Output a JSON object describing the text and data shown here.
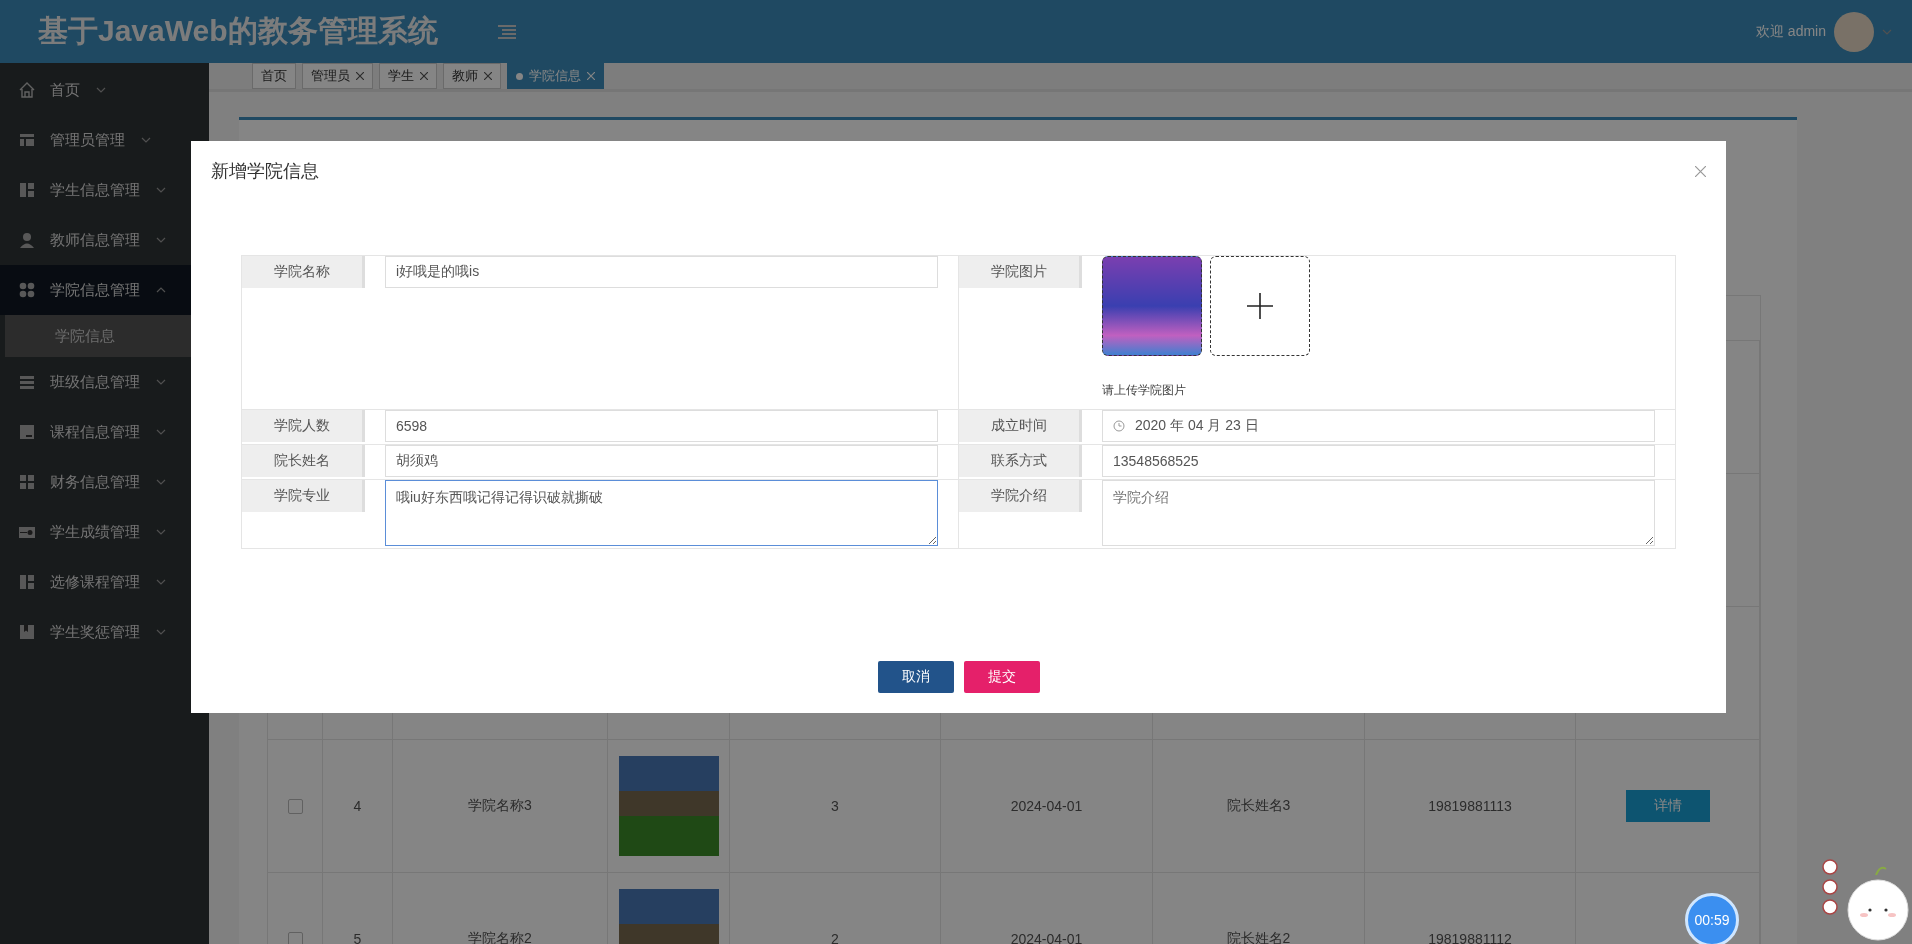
{
  "header": {
    "title": "基于JavaWeb的教务管理系统",
    "welcome": "欢迎 admin"
  },
  "sidebar": {
    "items": [
      {
        "label": "首页",
        "expanded": false
      },
      {
        "label": "管理员管理",
        "expanded": false
      },
      {
        "label": "学生信息管理",
        "expanded": false
      },
      {
        "label": "教师信息管理",
        "expanded": false
      },
      {
        "label": "学院信息管理",
        "expanded": true,
        "children": [
          {
            "label": "学院信息",
            "selected": true
          }
        ]
      },
      {
        "label": "班级信息管理",
        "expanded": false
      },
      {
        "label": "课程信息管理",
        "expanded": false
      },
      {
        "label": "财务信息管理",
        "expanded": false
      },
      {
        "label": "学生成绩管理",
        "expanded": false
      },
      {
        "label": "选修课程管理",
        "expanded": false
      },
      {
        "label": "学生奖惩管理",
        "expanded": false
      }
    ]
  },
  "tabs": [
    {
      "label": "首页",
      "closable": false,
      "selected": false
    },
    {
      "label": "管理员",
      "closable": true,
      "selected": false
    },
    {
      "label": "学生",
      "closable": true,
      "selected": false
    },
    {
      "label": "教师",
      "closable": true,
      "selected": false
    },
    {
      "label": "学院信息",
      "closable": true,
      "selected": true
    }
  ],
  "table": {
    "rows": [
      {
        "checked": false,
        "index": "4",
        "name": "学院名称3",
        "count": "3",
        "date": "2024-04-01",
        "dean": "院长姓名3",
        "phone": "19819881113",
        "action": "详情"
      },
      {
        "checked": false,
        "index": "5",
        "name": "学院名称2",
        "count": "2",
        "date": "2024-04-01",
        "dean": "院长姓名2",
        "phone": "19819881112"
      }
    ]
  },
  "modal": {
    "title": "新增学院信息",
    "fields": [
      {
        "kind": "text",
        "label": "学院名称",
        "value": "i好哦是的哦is"
      },
      {
        "kind": "image",
        "label": "学院图片",
        "hint": "请上传学院图片"
      },
      {
        "kind": "text",
        "label": "学院人数",
        "value": "6598"
      },
      {
        "kind": "date",
        "label": "成立时间",
        "value": "2020 年 04 月 23 日"
      },
      {
        "kind": "text",
        "label": "院长姓名",
        "value": "胡须鸡"
      },
      {
        "kind": "text",
        "label": "联系方式",
        "value": "13548568525"
      },
      {
        "kind": "textarea",
        "label": "学院专业",
        "value": "哦iu好东西哦记得记得识破就撕破",
        "focused": true
      },
      {
        "kind": "textarea",
        "label": "学院介绍",
        "placeholder": "学院介绍",
        "focused": false
      }
    ],
    "buttons": [
      {
        "label": "取消",
        "kind": "cancel"
      },
      {
        "label": "提交",
        "kind": "submit"
      }
    ]
  },
  "timer": "00:59"
}
